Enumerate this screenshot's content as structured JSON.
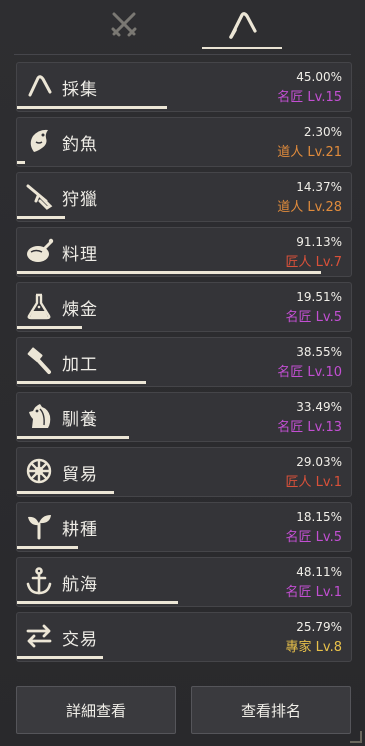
{
  "tabs": [
    {
      "icon": "crossed-swords-icon",
      "active": false
    },
    {
      "icon": "sickle-icon",
      "active": true
    }
  ],
  "skills": [
    {
      "icon": "sickle-icon",
      "name": "採集",
      "percent": "45.00%",
      "level": "名匠 Lv.15",
      "level_color": "#c24fd2",
      "progress": 0.45
    },
    {
      "icon": "fish-icon",
      "name": "釣魚",
      "percent": "2.30%",
      "level": "道人 Lv.21",
      "level_color": "#e08b3c",
      "progress": 0.023
    },
    {
      "icon": "rifle-icon",
      "name": "狩獵",
      "percent": "14.37%",
      "level": "道人 Lv.28",
      "level_color": "#e08b3c",
      "progress": 0.1437
    },
    {
      "icon": "roast-chicken-icon",
      "name": "料理",
      "percent": "91.13%",
      "level": "匠人 Lv.7",
      "level_color": "#d9513a",
      "progress": 0.9113
    },
    {
      "icon": "flask-icon",
      "name": "煉金",
      "percent": "19.51%",
      "level": "名匠 Lv.5",
      "level_color": "#c24fd2",
      "progress": 0.1951
    },
    {
      "icon": "hammer-icon",
      "name": "加工",
      "percent": "38.55%",
      "level": "名匠 Lv.10",
      "level_color": "#c24fd2",
      "progress": 0.3855
    },
    {
      "icon": "horse-head-icon",
      "name": "馴養",
      "percent": "33.49%",
      "level": "名匠 Lv.13",
      "level_color": "#c24fd2",
      "progress": 0.3349
    },
    {
      "icon": "wheel-icon",
      "name": "貿易",
      "percent": "29.03%",
      "level": "匠人 Lv.1",
      "level_color": "#d9513a",
      "progress": 0.2903
    },
    {
      "icon": "sprout-icon",
      "name": "耕種",
      "percent": "18.15%",
      "level": "名匠 Lv.5",
      "level_color": "#c24fd2",
      "progress": 0.1815
    },
    {
      "icon": "anchor-icon",
      "name": "航海",
      "percent": "48.11%",
      "level": "名匠 Lv.1",
      "level_color": "#c24fd2",
      "progress": 0.4811
    },
    {
      "icon": "exchange-arrows-icon",
      "name": "交易",
      "percent": "25.79%",
      "level": "專家 Lv.8",
      "level_color": "#e8c14a",
      "progress": 0.2579
    }
  ],
  "buttons": {
    "details": "詳細查看",
    "ranking": "查看排名"
  }
}
